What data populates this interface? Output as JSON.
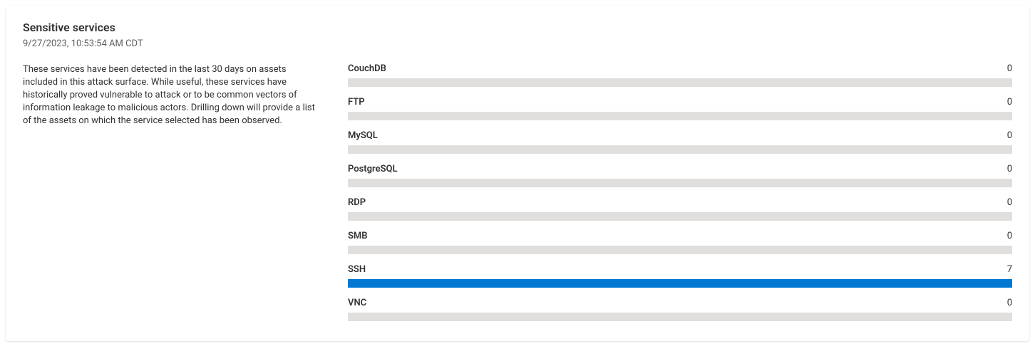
{
  "header": {
    "title": "Sensitive services",
    "timestamp": "9/27/2023, 10:53:54 AM CDT"
  },
  "description": "These services have been detected in the last 30 days on assets included in this attack surface. While useful, these services have historically proved vulnerable to attack or to be common vectors of information leakage to malicious actors. Drilling down will provide a list of the assets on which the service selected has been observed.",
  "chart_data": {
    "type": "bar",
    "categories": [
      "CouchDB",
      "FTP",
      "MySQL",
      "PostgreSQL",
      "RDP",
      "SMB",
      "SSH",
      "VNC"
    ],
    "values": [
      0,
      0,
      0,
      0,
      0,
      0,
      7,
      0
    ],
    "max": 7,
    "fill_color": "#0078d4",
    "track_color": "#e1dfdd"
  }
}
